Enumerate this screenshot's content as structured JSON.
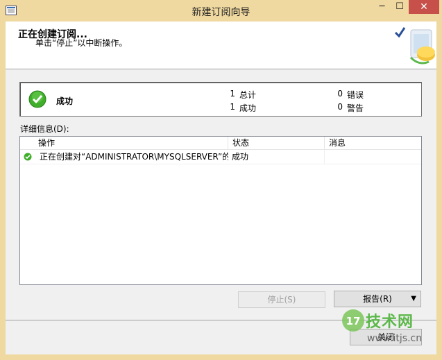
{
  "window": {
    "title": "新建订阅向导",
    "min_glyph": "─",
    "max_glyph": "☐",
    "close_glyph": "✕"
  },
  "header": {
    "title": "正在创建订阅...",
    "subtitle": "单击“停止”以中断操作。"
  },
  "summary": {
    "status": "成功",
    "total_count": "1",
    "total_label": "总计",
    "success_count": "1",
    "success_label": "成功",
    "error_count": "0",
    "error_label": "错误",
    "warning_count": "0",
    "warning_label": "警告"
  },
  "details_label": "详细信息(D):",
  "list": {
    "columns": [
      "操作",
      "状态",
      "消息"
    ],
    "rows": [
      {
        "action": "正在创建对“ADMINISTRATOR\\MYSQLSERVER”的...",
        "status": "成功",
        "message": ""
      }
    ]
  },
  "buttons": {
    "stop": "停止(S)",
    "report": "报告(R)",
    "report_caret": "▼",
    "close": "关闭"
  },
  "watermark": {
    "text": "技术网",
    "url": "www.itjs.cn",
    "badge": "17"
  },
  "colors": {
    "success_green": "#3fae2a",
    "title_bar": "#f0d9a0",
    "close_red": "#c7504b"
  }
}
